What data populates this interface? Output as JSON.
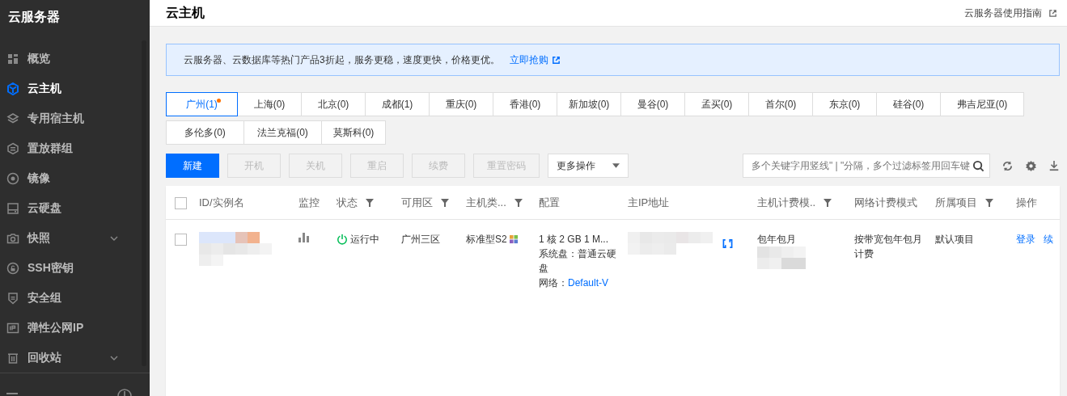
{
  "sidebar": {
    "title": "云服务器",
    "items": [
      {
        "label": "概览",
        "selected": false,
        "expandable": false
      },
      {
        "label": "云主机",
        "selected": true,
        "expandable": false
      },
      {
        "label": "专用宿主机",
        "selected": false,
        "expandable": false
      },
      {
        "label": "置放群组",
        "selected": false,
        "expandable": false
      },
      {
        "label": "镜像",
        "selected": false,
        "expandable": false
      },
      {
        "label": "云硬盘",
        "selected": false,
        "expandable": false
      },
      {
        "label": "快照",
        "selected": false,
        "expandable": true
      },
      {
        "label": "SSH密钥",
        "selected": false,
        "expandable": false
      },
      {
        "label": "安全组",
        "selected": false,
        "expandable": false
      },
      {
        "label": "弹性公网IP",
        "selected": false,
        "expandable": false
      },
      {
        "label": "回收站",
        "selected": false,
        "expandable": true
      }
    ]
  },
  "header": {
    "title": "云主机",
    "guide_link": "云服务器使用指南"
  },
  "notice": {
    "text": "云服务器、云数据库等热门产品3折起，服务更稳，速度更快，价格更优。",
    "link": "立即抢购"
  },
  "regions": [
    {
      "label": "广州(1)",
      "selected": true,
      "dot": true
    },
    {
      "label": "上海(0)",
      "selected": false,
      "dot": false
    },
    {
      "label": "北京(0)",
      "selected": false,
      "dot": false
    },
    {
      "label": "成都(1)",
      "selected": false,
      "dot": false
    },
    {
      "label": "重庆(0)",
      "selected": false,
      "dot": false
    },
    {
      "label": "香港(0)",
      "selected": false,
      "dot": false
    },
    {
      "label": "新加坡(0)",
      "selected": false,
      "dot": false
    },
    {
      "label": "曼谷(0)",
      "selected": false,
      "dot": false
    },
    {
      "label": "孟买(0)",
      "selected": false,
      "dot": false
    },
    {
      "label": "首尔(0)",
      "selected": false,
      "dot": false
    },
    {
      "label": "东京(0)",
      "selected": false,
      "dot": false
    },
    {
      "label": "硅谷(0)",
      "selected": false,
      "dot": false
    },
    {
      "label": "弗吉尼亚(0)",
      "selected": false,
      "dot": false
    },
    {
      "label": "多伦多(0)",
      "selected": false,
      "dot": false
    },
    {
      "label": "法兰克福(0)",
      "selected": false,
      "dot": false
    },
    {
      "label": "莫斯科(0)",
      "selected": false,
      "dot": false
    }
  ],
  "toolbar": {
    "buttons": [
      {
        "label": "新建",
        "kind": "primary",
        "disabled": false
      },
      {
        "label": "开机",
        "kind": "normal",
        "disabled": true
      },
      {
        "label": "关机",
        "kind": "normal",
        "disabled": true
      },
      {
        "label": "重启",
        "kind": "normal",
        "disabled": true
      },
      {
        "label": "续费",
        "kind": "normal",
        "disabled": true
      },
      {
        "label": "重置密码",
        "kind": "normal",
        "disabled": true
      },
      {
        "label": "更多操作",
        "kind": "dropdown",
        "disabled": false
      }
    ],
    "search": {
      "placeholder": "多个关键字用竖线\" | \"分隔，多个过滤标签用回车键"
    }
  },
  "table": {
    "all_checked": false,
    "columns": [
      {
        "label": "ID/实例名",
        "filter": false
      },
      {
        "label": "监控",
        "filter": false
      },
      {
        "label": "状态",
        "filter": true
      },
      {
        "label": "可用区",
        "filter": true
      },
      {
        "label": "主机类...",
        "filter": true
      },
      {
        "label": "配置",
        "filter": false
      },
      {
        "label": "主IP地址",
        "filter": false
      },
      {
        "label": "主机计费模..",
        "filter": true
      },
      {
        "label": "网络计费模式",
        "filter": false
      },
      {
        "label": "所属项目",
        "filter": true
      },
      {
        "label": "操作",
        "filter": false
      }
    ],
    "rows": [
      {
        "checked": false,
        "status": "运行中",
        "zone": "广州三区",
        "type": "标准型S2",
        "config": [
          "1 核 2 GB 1 M...",
          "系统盘：普通云硬盘"
        ],
        "network_label": "网络：",
        "network_link": "Default-V",
        "billing": "包年包月",
        "net_billing": "按带宽包年包月计费",
        "project": "默认项目",
        "actions": [
          "登录",
          "续"
        ]
      }
    ]
  }
}
